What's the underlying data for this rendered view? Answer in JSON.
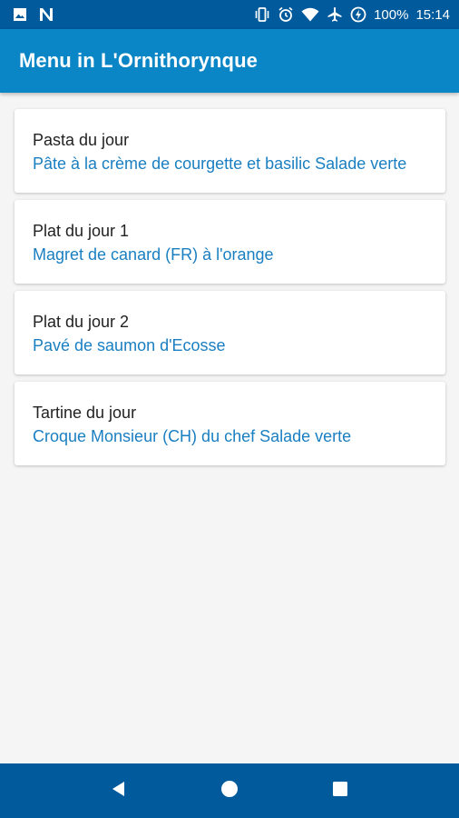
{
  "status_bar": {
    "battery": "100%",
    "time": "15:14",
    "icons": [
      "image-icon",
      "n-app-icon",
      "vibrate-icon",
      "alarm-icon",
      "wifi-icon",
      "airplane-icon",
      "battery-charging-icon"
    ]
  },
  "app_bar": {
    "title": "Menu in L'Ornithorynque"
  },
  "menu": {
    "items": [
      {
        "title": "Pasta du jour",
        "description": "Pâte à la crème de courgette et basilic Salade verte"
      },
      {
        "title": "Plat du jour 1",
        "description": "Magret de canard (FR) à l'orange"
      },
      {
        "title": "Plat du jour 2",
        "description": "Pavé de saumon d'Ecosse"
      },
      {
        "title": "Tartine du jour",
        "description": "Croque Monsieur (CH) du chef Salade verte"
      }
    ]
  },
  "nav_bar": {
    "icons": [
      "back-icon",
      "home-icon",
      "recents-icon"
    ]
  },
  "colors": {
    "status_bar": "#005a9c",
    "app_bar": "#0a86c6",
    "accent_text": "#1a7fc1",
    "background": "#f5f5f5"
  }
}
